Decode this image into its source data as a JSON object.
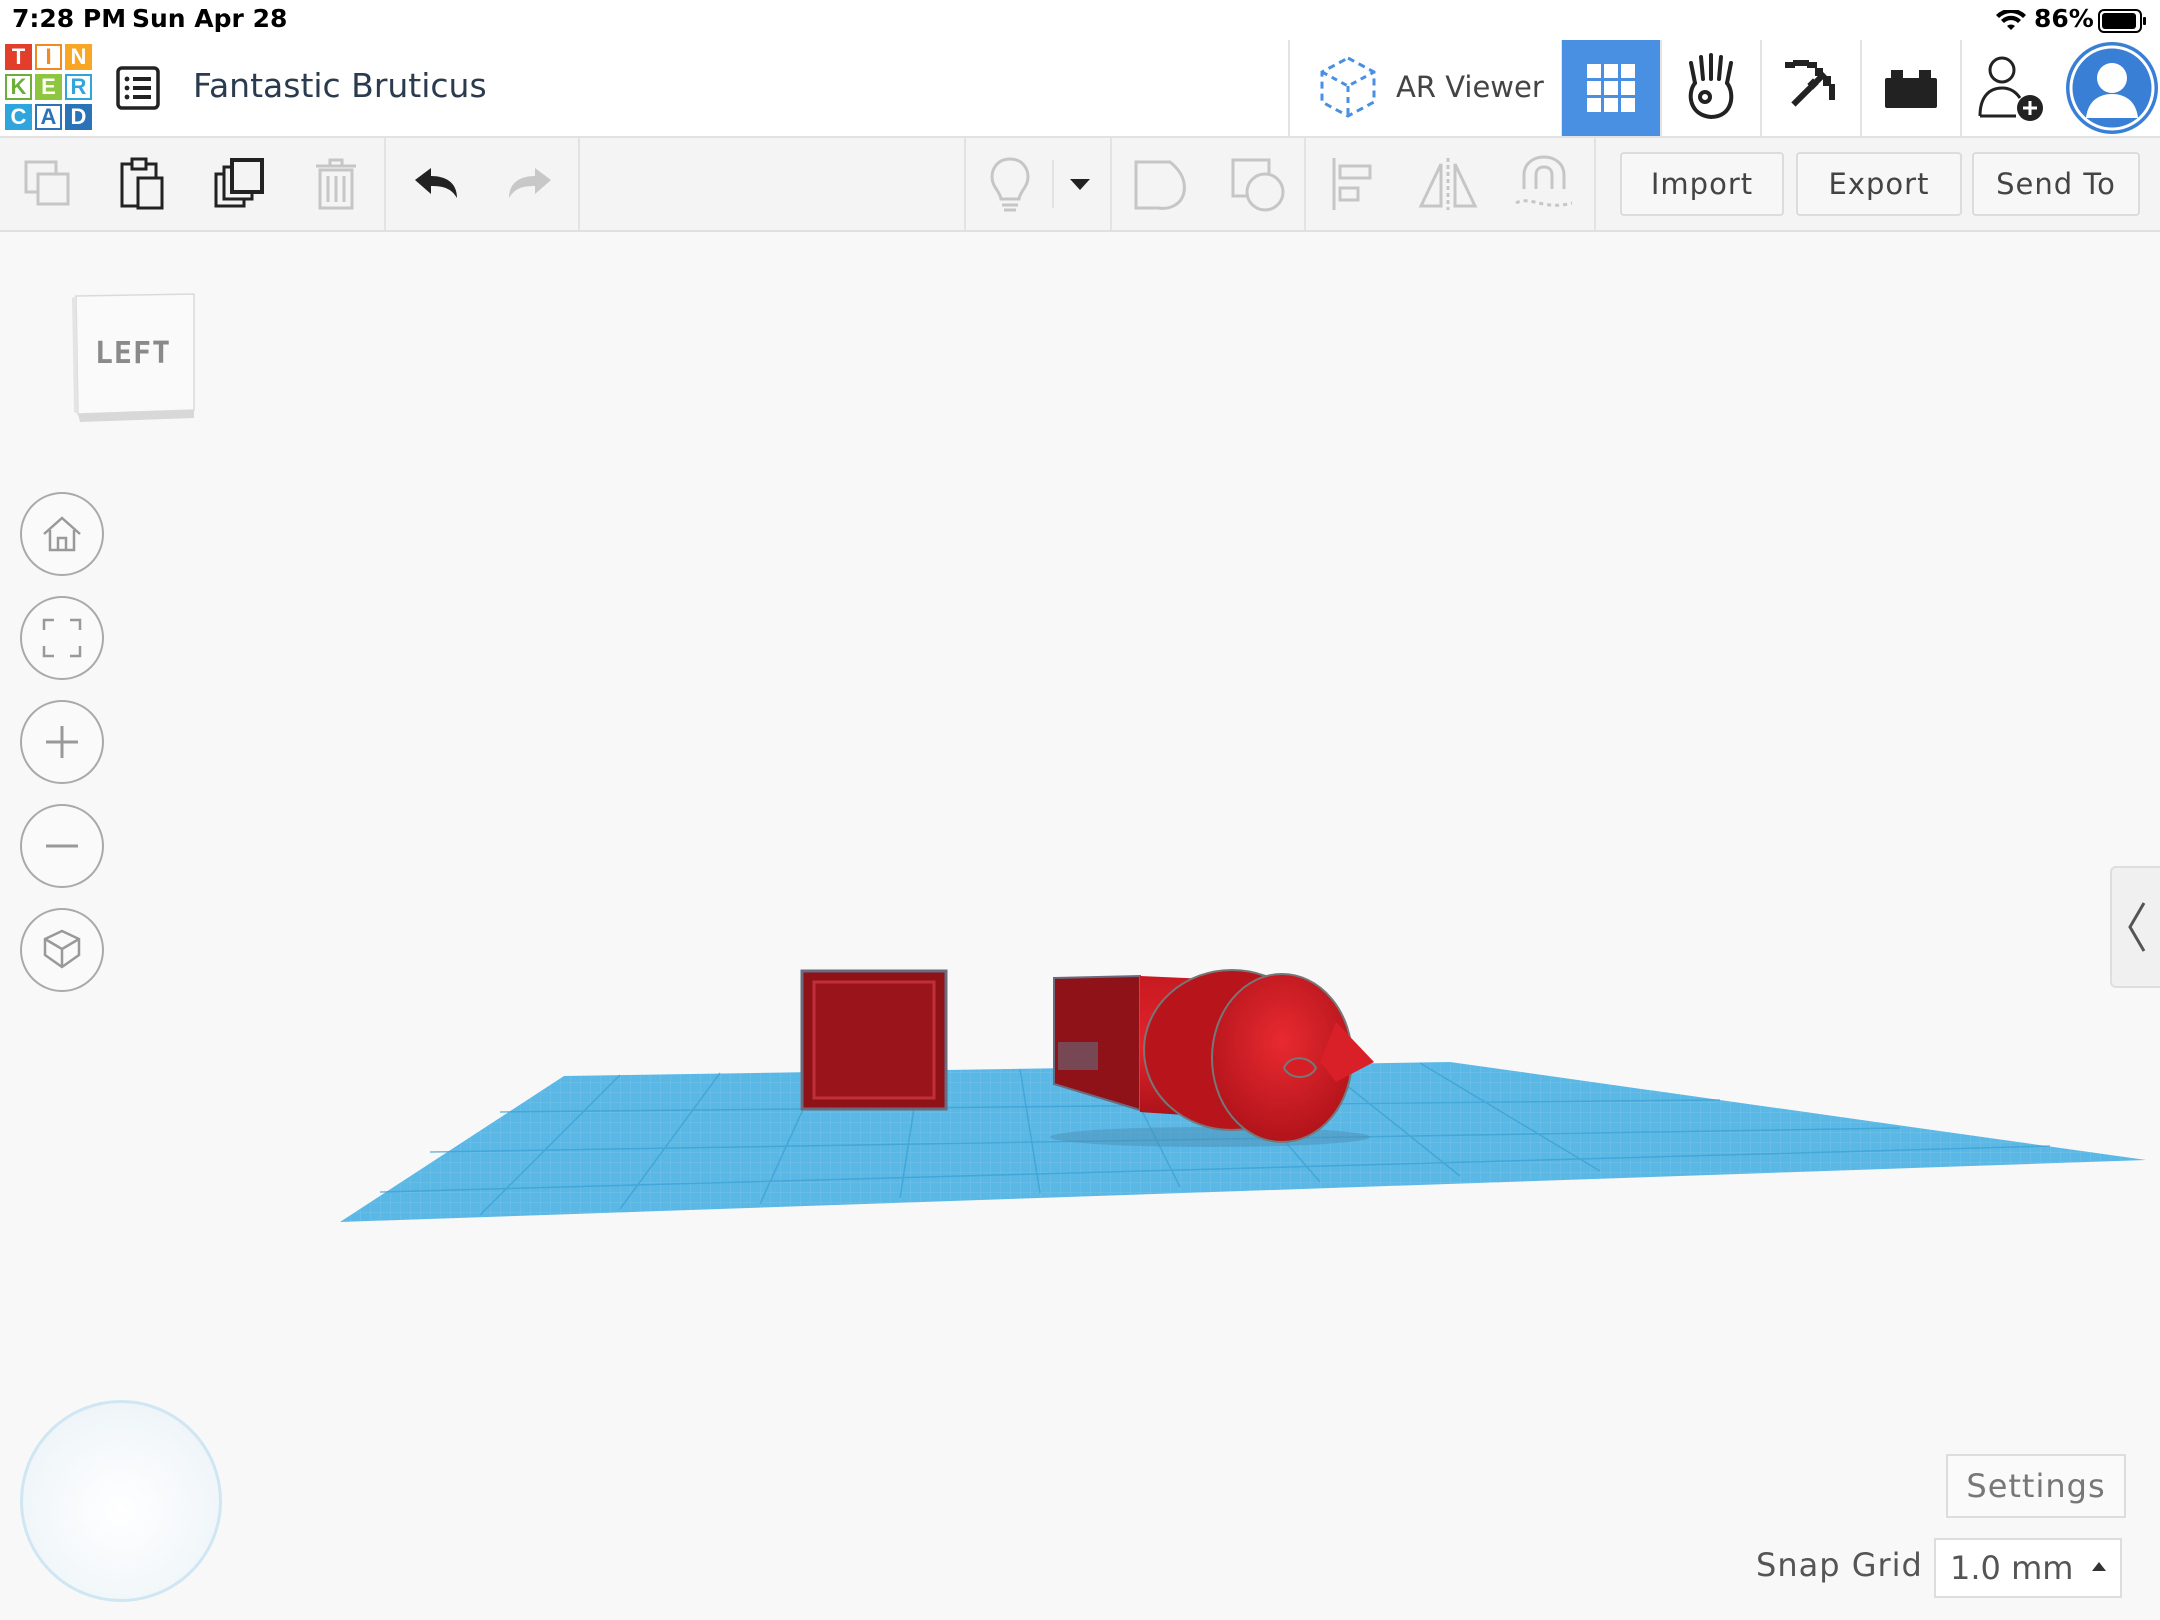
{
  "status_bar": {
    "time": "7:28 PM",
    "date": "Sun Apr 28",
    "battery_percent": "86%"
  },
  "logo": {
    "letters": [
      "T",
      "I",
      "N",
      "K",
      "E",
      "R",
      "C",
      "A",
      "D"
    ],
    "colors": [
      "#e23e2b",
      "#f8a623",
      "#f8a623",
      "#8ec63f",
      "#8ec63f",
      "#2fa5dd",
      "#2fa5dd",
      "#2b73b8",
      "#2b73b8"
    ]
  },
  "header": {
    "design_title": "Fantastic Bruticus",
    "ar_viewer_label": "AR Viewer",
    "active_view": "3d-design-grid",
    "accent_color": "#4a90e2"
  },
  "toolbar": {
    "import_label": "Import",
    "export_label": "Export",
    "send_to_label": "Send To"
  },
  "viewcube": {
    "face_label": "LEFT"
  },
  "bottom": {
    "settings_label": "Settings",
    "snap_grid_label": "Snap Grid",
    "snap_grid_value": "1.0 mm"
  },
  "scene": {
    "workplane_color": "#5ab8e6",
    "object_color": "#c8161e"
  }
}
